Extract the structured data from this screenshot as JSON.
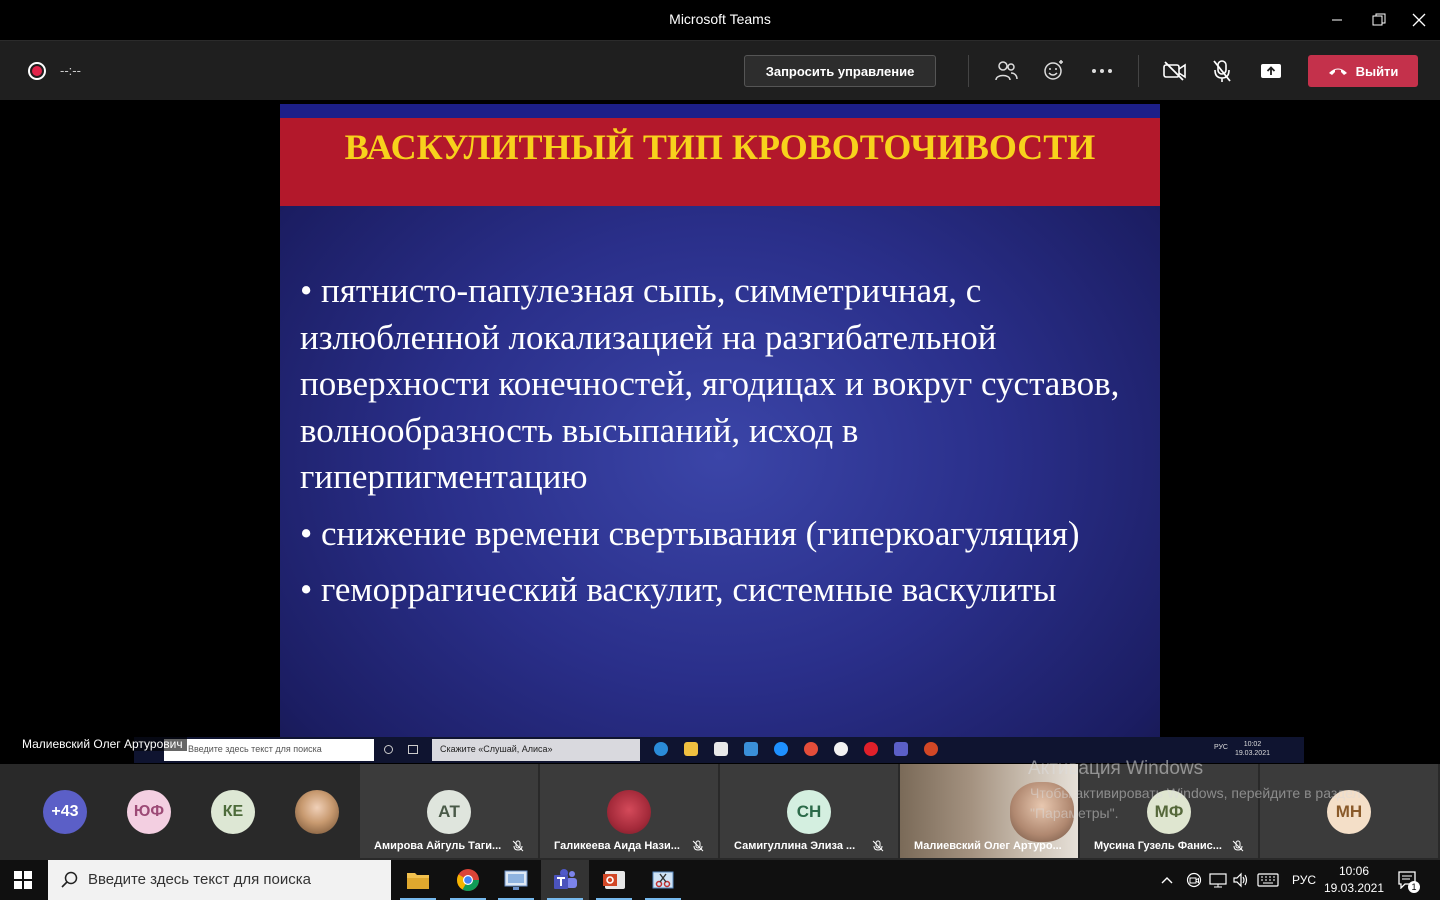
{
  "window": {
    "title": "Microsoft Teams",
    "minimize_icon": "minimize-icon",
    "restore_icon": "restore-icon",
    "close_icon": "close-icon"
  },
  "toolbar": {
    "timer": "--:--",
    "request_control_label": "Запросить управление",
    "leave_label": "Выйти",
    "colors": {
      "leave": "#c4314b",
      "record": "#e0244a"
    }
  },
  "slide": {
    "title": "ВАСКУЛИТНЫЙ ТИП КРОВОТОЧИВОСТИ",
    "bullets": [
      "• пятнисто-папулезная сыпь, симметричная, с излюбленной локализацией на разгибательной поверхности конечностей, ягодицах и вокруг суставов, волнообразность высыпаний, исход в гиперпигментацию",
      "• снижение времени свертывания (гиперкоагуляция)",
      "• геморрагический васкулит, системные васкулиты"
    ],
    "colors": {
      "title_band": "#b3182b",
      "title_text": "#f7d21c",
      "background": "#2a2f8a"
    }
  },
  "presenter": {
    "name": "Малиевский Олег Артурович"
  },
  "presenter_taskbar": {
    "search_placeholder": "Введите здесь текст для поиска",
    "alice_placeholder": "Скажите «Слушай, Алиса»",
    "lang": "РУС",
    "time": "10:02",
    "date": "19.03.2021"
  },
  "participants": {
    "overflow": "+43",
    "avatars": [
      {
        "initials": "ЮФ",
        "color": "#f3cfe1"
      },
      {
        "initials": "КЕ",
        "color": "#dde7d4"
      }
    ],
    "tiles": [
      {
        "initials": "АТ",
        "name": "Амирова Айгуль Таги...",
        "color": "#dfe5dd"
      },
      {
        "initials": "",
        "name": "Галикеева Аида Нази...",
        "color": "#b33a4a"
      },
      {
        "initials": "СН",
        "name": "Самигуллина Элиза ...",
        "color": "#d4efe0"
      },
      {
        "initials": "",
        "name": "Малиевский Олег Артуро...",
        "color": "#9a8a78"
      },
      {
        "initials": "МФ",
        "name": "Мусина Гузель Фанис...",
        "color": "#dfe6d0"
      },
      {
        "initials": "МН",
        "name": "",
        "color": "#f4dfc8"
      }
    ]
  },
  "watermark": {
    "title": "Активация Windows",
    "text": "Чтобы активировать Windows, перейдите в раздел \"Параметры\"."
  },
  "taskbar": {
    "search_placeholder": "Введите здесь текст для поиска",
    "lang": "РУС",
    "time": "10:06",
    "date": "19.03.2021",
    "notification_count": "1"
  }
}
